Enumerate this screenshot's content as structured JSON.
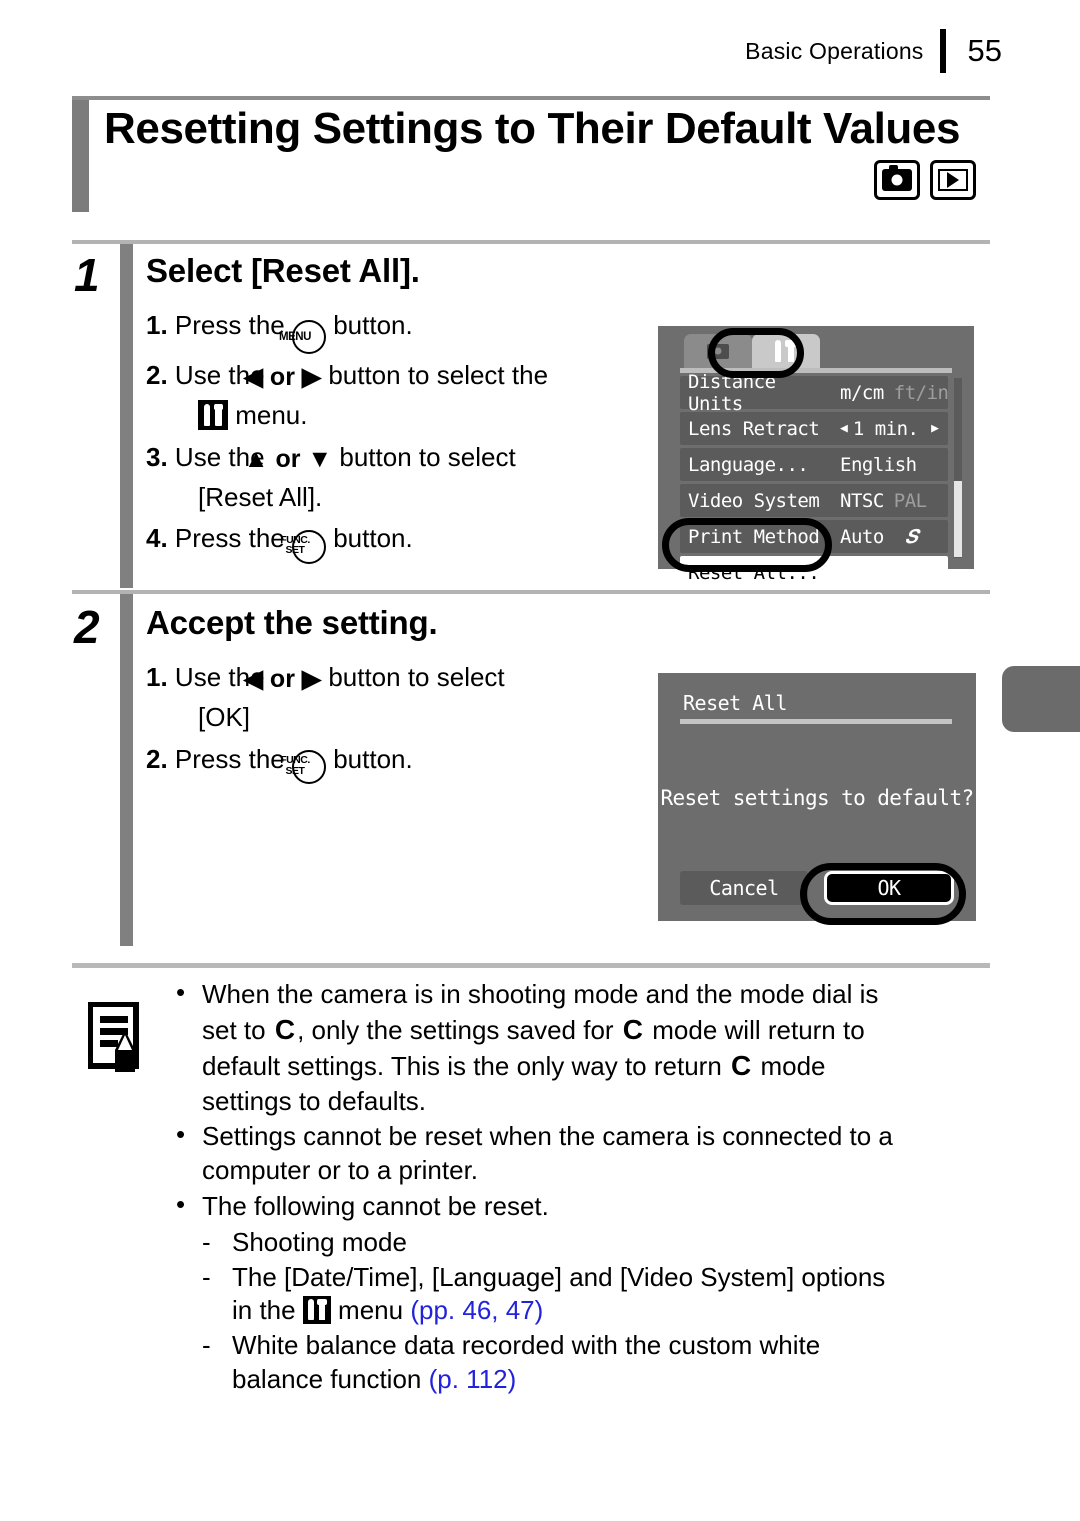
{
  "header": {
    "chapter": "Basic Operations",
    "page_number": "55"
  },
  "title": "Resetting Settings to Their Default Values",
  "mode_icons": [
    {
      "name": "shooting-mode-icon",
      "label": "camera"
    },
    {
      "name": "playback-mode-icon",
      "label": "playback"
    }
  ],
  "steps": [
    {
      "number": "1",
      "heading": "Select [Reset All].",
      "items": [
        {
          "num": "1.",
          "pre": "Press the ",
          "btn": "MENU",
          "post": " button."
        },
        {
          "num": "2.",
          "pre": "Use the ",
          "arrows": "◀ or ▶",
          "post": " button to select the",
          "post2": " menu."
        },
        {
          "num": "3.",
          "pre": "Use the ",
          "arrows": "▲ or ▼",
          "post": " button to select",
          "post2": "[Reset All]."
        },
        {
          "num": "4.",
          "pre": "Press the ",
          "btn": "FUNC./SET",
          "post": " button."
        }
      ]
    },
    {
      "number": "2",
      "heading": "Accept the setting.",
      "items": [
        {
          "num": "1.",
          "pre": "Use the ",
          "arrows": "◀ or ▶",
          "post": " button to select",
          "post2": "[OK]"
        },
        {
          "num": "2.",
          "pre": "Press the ",
          "btn": "FUNC./SET",
          "post": " button."
        }
      ]
    }
  ],
  "buttons": {
    "menu_label": "MENU",
    "func_label": "FUNC.",
    "set_label": "SET"
  },
  "lcd_menu": {
    "tabs": [
      {
        "name": "camera-tab",
        "active": false
      },
      {
        "name": "settings-tab",
        "active": true
      }
    ],
    "rows": [
      {
        "label": "Distance Units",
        "value_on": "m/cm",
        "value_off": "ft/in"
      },
      {
        "label": "Lens Retract",
        "value_on": "1 min.",
        "has_arrows": true
      },
      {
        "label": "Language...",
        "value_on": "English"
      },
      {
        "label": "Video System",
        "value_on": "NTSC",
        "value_off": "PAL"
      },
      {
        "label": "Print Method",
        "value_on": "Auto",
        "value_off": ""
      }
    ],
    "selected_row": "Reset All..."
  },
  "lcd_dialog": {
    "title": "Reset All",
    "question": "Reset settings to default?",
    "cancel_label": "Cancel",
    "ok_label": "OK"
  },
  "notes": {
    "bullet1_line1": "When the camera is in shooting mode and the mode dial is",
    "bullet1_line2_a": "set to ",
    "bullet1_mode": "C",
    "bullet1_line2_b": ", only the settings saved for ",
    "bullet1_line2_c": " mode will return to",
    "bullet1_line3_a": "default settings. This is the only way to return ",
    "bullet1_line3_b": " mode",
    "bullet1_line4": "settings to defaults.",
    "bullet2_line1": "Settings cannot be reset when the camera is connected to a",
    "bullet2_line2": "computer or to a printer.",
    "bullet3": "The following cannot be reset.",
    "sub1": "Shooting mode",
    "sub2_line1": "The [Date/Time], [Language] and [Video System] options",
    "sub2_line2_a": "in the ",
    "sub2_line2_b": " menu ",
    "sub2_ref": "(pp. 46, 47)",
    "sub3_line1": "White balance data recorded with the custom white",
    "sub3_line2_a": "balance function ",
    "sub3_ref": "(p. 112)"
  },
  "colors": {
    "link": "#2222dd",
    "step_bar": "#808080",
    "lcd_bg": "#6d6d6d"
  }
}
